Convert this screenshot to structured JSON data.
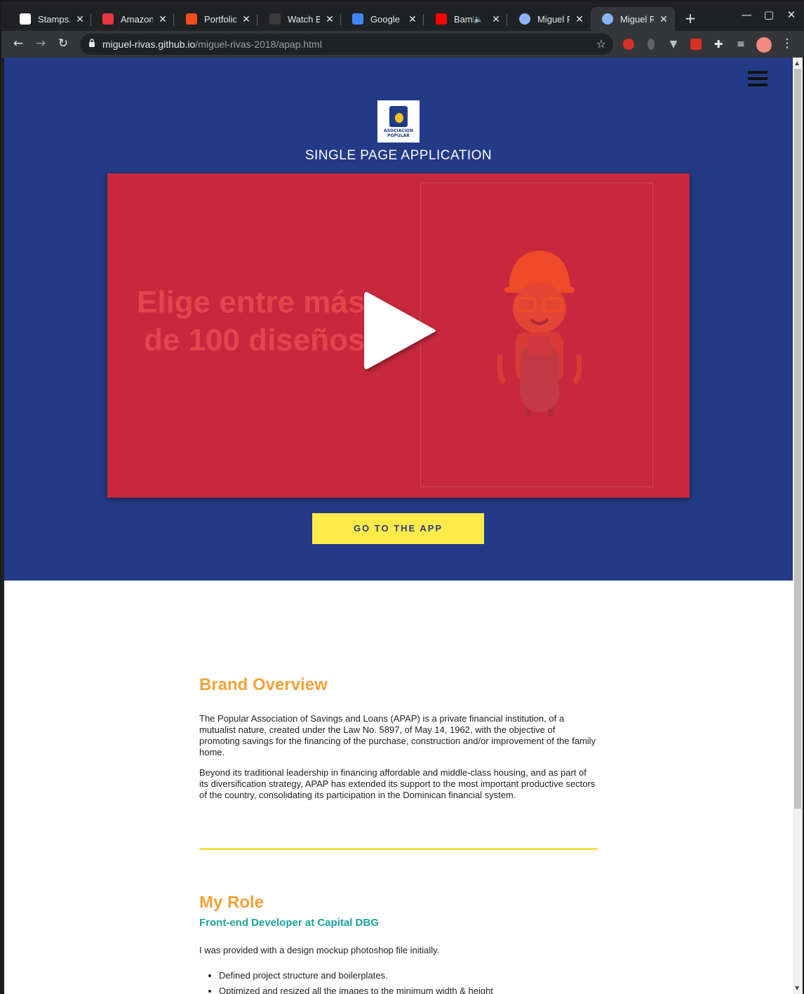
{
  "browser": {
    "tabs": [
      {
        "title": "Stamps.c",
        "favicon_color": "#ffffff",
        "active": false
      },
      {
        "title": "Amazon I",
        "favicon_color": "#e8373e",
        "active": false
      },
      {
        "title": "Portfolio",
        "favicon_color": "#f24e1e",
        "active": false
      },
      {
        "title": "Watch Bi",
        "favicon_color": "#3c3c3c",
        "active": false
      },
      {
        "title": "Google C",
        "favicon_color": "#4285f4",
        "active": false
      },
      {
        "title": "Bamb",
        "favicon_color": "#ff0000",
        "active": false
      },
      {
        "title": "Miguel R",
        "favicon_color": "#8ab4f8",
        "active": false
      },
      {
        "title": "Miguel R",
        "favicon_color": "#8ab4f8",
        "active": true
      }
    ],
    "new_tab": "+",
    "url_host": "miguel-rivas.github.io",
    "url_path": "/miguel-rivas-2018/apap.html"
  },
  "page": {
    "logo_text": "ASOCIACION POPULAR",
    "hero_title": "SINGLE PAGE APPLICATION",
    "video": {
      "line1": "Elige entre más",
      "line2": "de 100 diseños"
    },
    "cta_label": "GO TO THE APP",
    "brand_overview": {
      "title": "Brand Overview",
      "p1": "The Popular Association of Savings and Loans (APAP) is a private financial institution, of a mutualist nature, created under the Law No. 5897, of May 14, 1962, with the objective of promoting savings for the financing of the purchase, construction and/or improvement of the family home.",
      "p2": "Beyond its traditional leadership in financing affordable and middle-class housing, and as part of its diversification strategy, APAP has extended its support to the most important productive sectors of the country, consolidating its participation in the Dominican financial system."
    },
    "my_role": {
      "title": "My Role",
      "subtitle": "Front-end Developer at Capital DBG",
      "intro": "I was provided with a design mockup photoshop file initially.",
      "items": [
        "Defined project structure and boilerplates.",
        "Optimized and resized all the images to the minimum width & height"
      ]
    }
  },
  "colors": {
    "hero_bg": "#233a86",
    "video_bg": "#c7283d",
    "cta_bg": "#fdeb4a",
    "heading": "#f2a23a",
    "subheading": "#1aa39a"
  }
}
